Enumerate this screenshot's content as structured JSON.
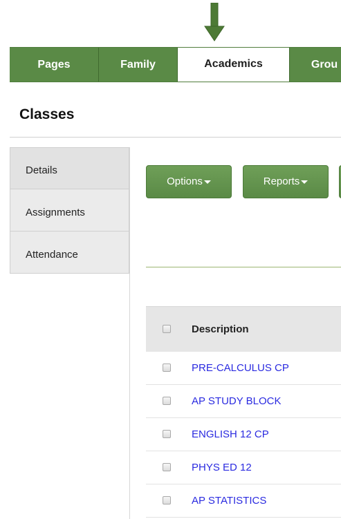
{
  "tabs": [
    {
      "label": "Pages",
      "active": false
    },
    {
      "label": "Family",
      "active": false
    },
    {
      "label": "Academics",
      "active": true
    },
    {
      "label": "Grou",
      "active": false
    }
  ],
  "page_title": "Classes",
  "sidebar": {
    "items": [
      {
        "label": "Details",
        "selected": true
      },
      {
        "label": "Assignments",
        "selected": false
      },
      {
        "label": "Attendance",
        "selected": false
      }
    ]
  },
  "toolbar": {
    "options_label": "Options",
    "reports_label": "Reports"
  },
  "table": {
    "header": "Description",
    "rows": [
      "PRE-CALCULUS CP",
      "AP STUDY BLOCK",
      "ENGLISH 12 CP",
      "PHYS ED 12",
      "AP STATISTICS"
    ]
  },
  "colors": {
    "brand_green": "#5a8a46",
    "link_blue": "#2a2ae0",
    "annotation_arrow": "#4d7a35"
  },
  "icons": {
    "annotation": "arrow-down-icon",
    "dropdown": "caret-down-icon",
    "checkbox": "checkbox-icon"
  }
}
